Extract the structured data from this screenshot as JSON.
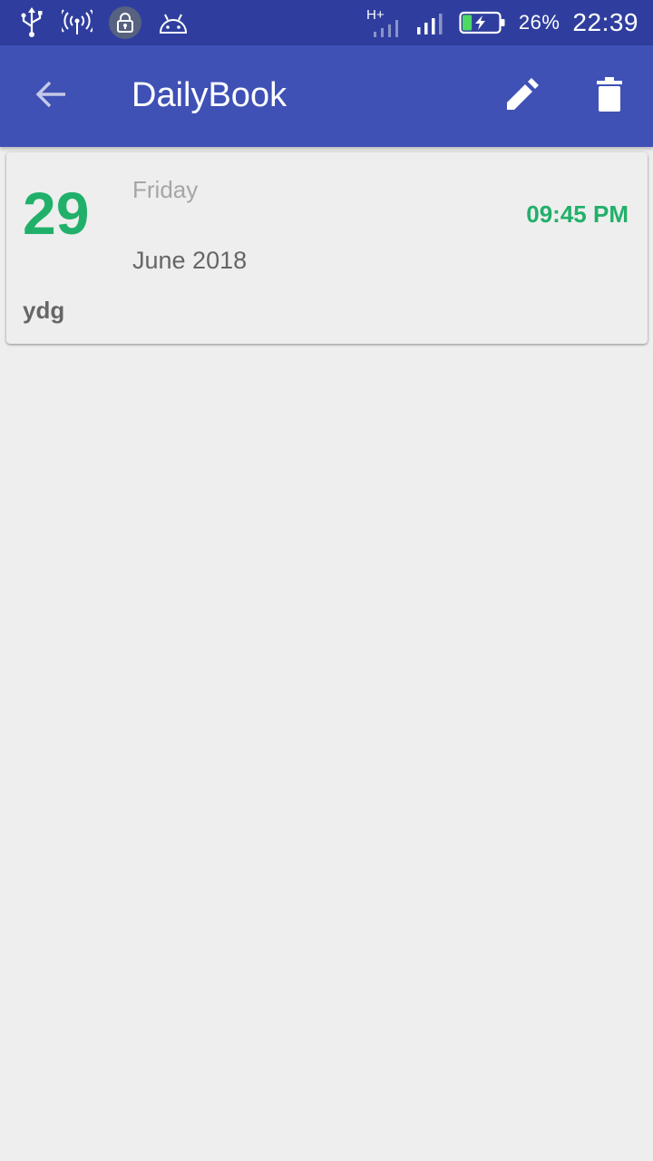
{
  "status_bar": {
    "icons_left": [
      "usb-icon",
      "hotspot-icon",
      "vpn-lock-icon",
      "android-debug-icon"
    ],
    "network_type": "H+",
    "battery_percent": "26%",
    "battery_level": 0.26,
    "time": "22:39"
  },
  "app_bar": {
    "title": "DailyBook",
    "back_icon": "arrow-back-icon",
    "edit_icon": "pencil-icon",
    "delete_icon": "trash-icon"
  },
  "entry": {
    "day": "29",
    "weekday": "Friday",
    "month_year": "June 2018",
    "time": "09:45 PM",
    "text": "ydg"
  },
  "colors": {
    "status_bar": "#2f3e9e",
    "app_bar": "#3f51b5",
    "accent_green": "#21b06a",
    "background": "#eeeeee"
  }
}
